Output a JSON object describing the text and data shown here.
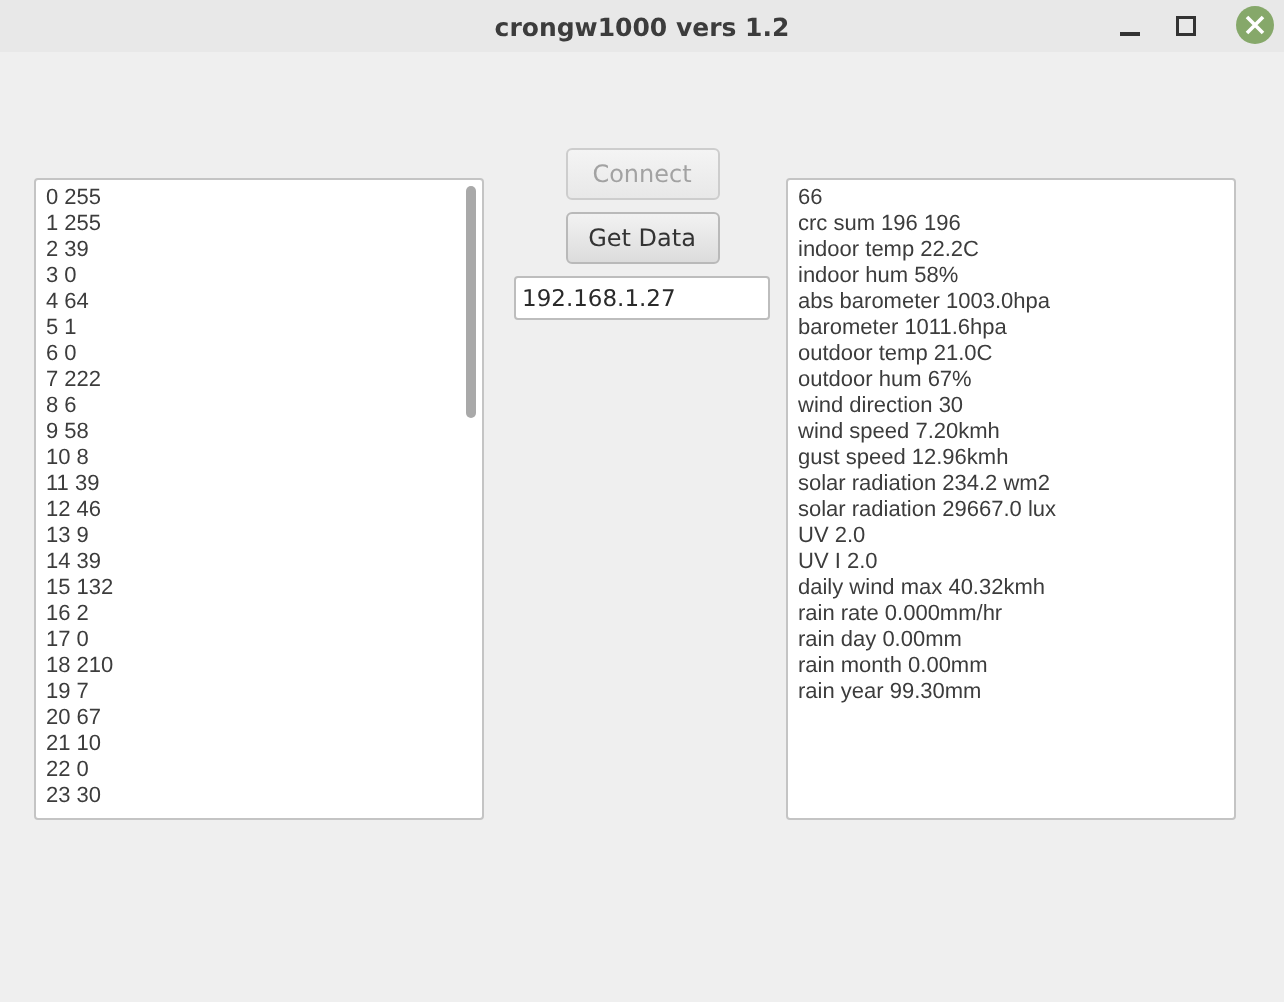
{
  "window": {
    "title": "crongw1000 vers 1.2"
  },
  "raw_list": [
    "0 255",
    "1 255",
    "2 39",
    "3 0",
    "4 64",
    "5 1",
    "6 0",
    "7 222",
    "8 6",
    "9 58",
    "10 8",
    "11 39",
    "12 46",
    "13 9",
    "14 39",
    "15 132",
    "16 2",
    "17 0",
    "18 210",
    "19 7",
    "20 67",
    "21 10",
    "22 0",
    "23 30"
  ],
  "buttons": [
    {
      "label": "Connect",
      "disabled": true
    },
    {
      "label": "Get Data",
      "disabled": false
    }
  ],
  "address_field": {
    "value": "192.168.1.27"
  },
  "readings": [
    "66",
    "crc sum 196 196",
    "indoor temp 22.2C",
    "indoor hum 58%",
    "abs barometer 1003.0hpa",
    "barometer 1011.6hpa",
    "outdoor temp 21.0C",
    "outdoor hum 67%",
    "wind direction 30",
    "wind speed 7.20kmh",
    "gust speed 12.96kmh",
    "solar radiation 234.2 wm2",
    "solar radiation 29667.0 lux",
    "UV 2.0",
    "UV I 2.0",
    "daily wind max 40.32kmh",
    "rain rate 0.000mm/hr",
    "rain day 0.00mm",
    "rain month 0.00mm",
    "rain year 99.30mm"
  ]
}
